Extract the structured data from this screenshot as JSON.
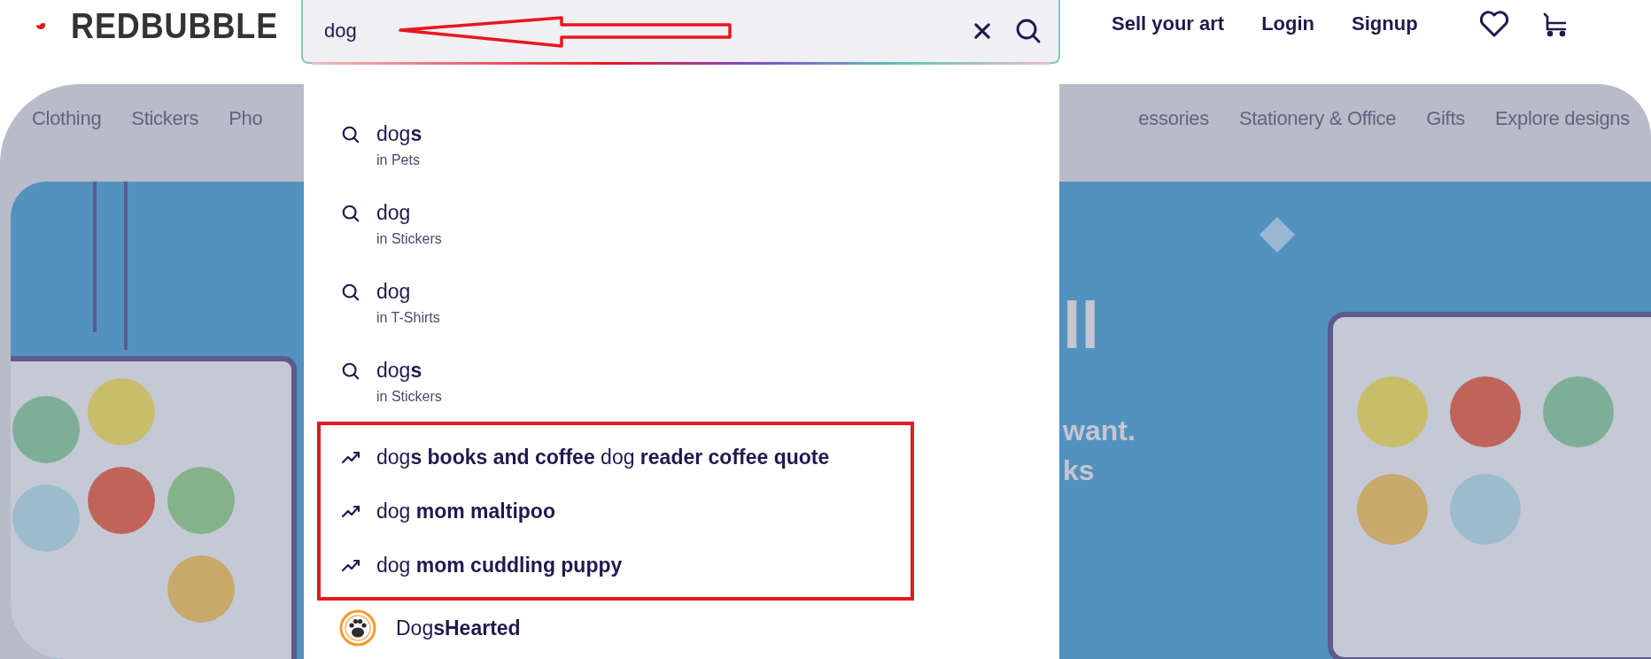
{
  "header": {
    "logo": "REDBUBBLE",
    "search": {
      "value": "dog"
    },
    "links": [
      "Sell your art",
      "Login",
      "Signup"
    ]
  },
  "nav": {
    "left": [
      "Clothing",
      "Stickers",
      "Pho"
    ],
    "right": [
      "essories",
      "Stationery & Office",
      "Gifts",
      "Explore designs"
    ]
  },
  "banner": {
    "kind": "picture",
    "texts": [
      {
        "kind": "headline",
        "text": "ll"
      },
      {
        "kind": "line",
        "text": "want."
      },
      {
        "kind": "line",
        "text": "ks"
      }
    ]
  },
  "suggestions": [
    {
      "kind": "search",
      "text": "dog**s**",
      "category": "in Pets",
      "highlighted": false
    },
    {
      "kind": "search",
      "text": "dog",
      "category": "in Stickers",
      "highlighted": false
    },
    {
      "kind": "search",
      "text": "dog",
      "category": "in T-Shirts",
      "highlighted": false
    },
    {
      "kind": "search",
      "text": "dog**s**",
      "category": "in Stickers",
      "highlighted": false
    },
    {
      "kind": "trending",
      "text": "dog**s books and coffee** dog **reader coffee quote**",
      "highlighted": true
    },
    {
      "kind": "trending",
      "text": "dog **mom maltipoo**",
      "highlighted": true
    },
    {
      "kind": "trending",
      "text": "dog **mom cuddling puppy**",
      "highlighted": true
    },
    {
      "kind": "artist",
      "text": "Dog**sHearted**",
      "highlighted": false
    }
  ]
}
